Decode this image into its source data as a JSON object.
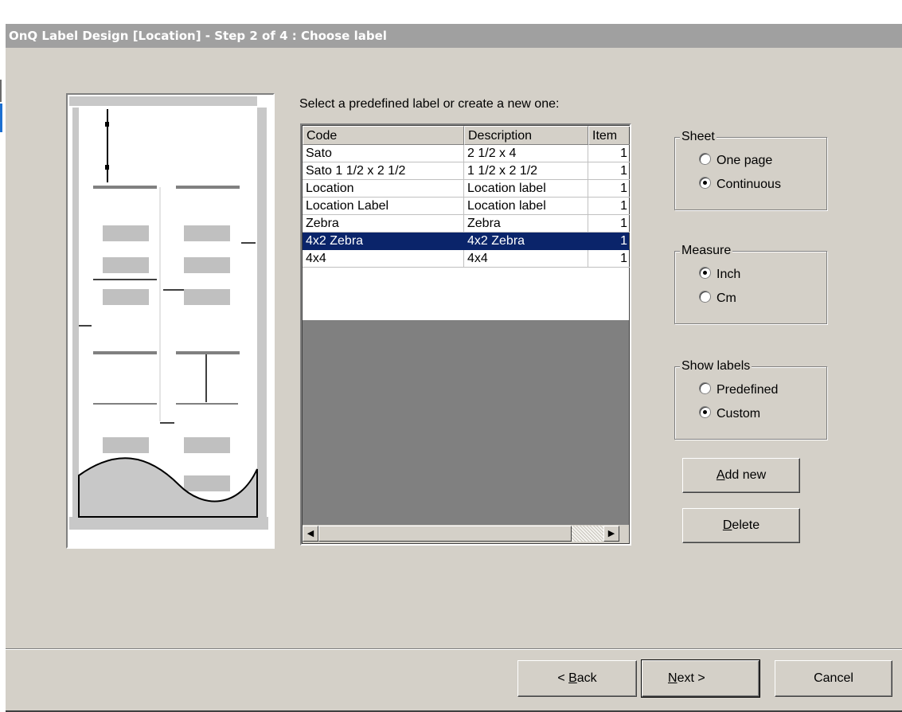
{
  "window": {
    "title": "OnQ Label Design [Location] - Step 2 of 4 : Choose label"
  },
  "prompt": "Select a predefined label or create a new one:",
  "labels_table": {
    "columns": [
      "Code",
      "Description",
      "Item"
    ],
    "rows": [
      {
        "code": "Sato",
        "description": "2 1/2 x 4",
        "item": "1"
      },
      {
        "code": "Sato 1 1/2 x 2 1/2",
        "description": "1 1/2 x 2 1/2",
        "item": "1"
      },
      {
        "code": "Location",
        "description": "Location label",
        "item": "1"
      },
      {
        "code": "Location Label",
        "description": "Location label",
        "item": "1"
      },
      {
        "code": "Zebra",
        "description": "Zebra",
        "item": "1"
      },
      {
        "code": "4x2 Zebra",
        "description": "4x2 Zebra",
        "item": "1"
      },
      {
        "code": "4x4",
        "description": "4x4",
        "item": "1"
      }
    ],
    "selected_row": "4x2 Zebra"
  },
  "sheet": {
    "legend": "Sheet",
    "options": [
      "One page",
      "Continuous"
    ],
    "selected": "Continuous"
  },
  "measure": {
    "legend": "Measure",
    "options": [
      "Inch",
      "Cm"
    ],
    "selected": "Inch"
  },
  "show_labels": {
    "legend": "Show labels",
    "options": [
      "Predefined",
      "Custom"
    ],
    "selected": "Custom"
  },
  "buttons": {
    "add_new": {
      "accel": "A",
      "rest": "dd new"
    },
    "delete": {
      "accel": "D",
      "rest": "elete"
    },
    "back": {
      "pre": "< ",
      "accel": "B",
      "rest": "ack"
    },
    "next": {
      "accel": "N",
      "rest": "ext >"
    },
    "cancel": "Cancel"
  },
  "icons": {
    "scroll_left": "scroll-left-arrow-icon",
    "scroll_right": "scroll-right-arrow-icon"
  },
  "colors": {
    "selection": "#0a246a",
    "dialog_bg": "#d4d0c8",
    "title_bg": "#a0a0a0"
  }
}
